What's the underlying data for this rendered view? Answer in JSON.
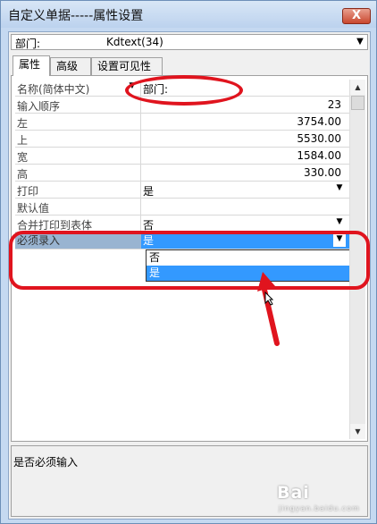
{
  "window": {
    "title": "自定义单据-----属性设置",
    "close": "X"
  },
  "object_combo": {
    "label": "部门:",
    "value": "Kdtext(34)"
  },
  "tabs": [
    {
      "label": "属性"
    },
    {
      "label": "高级"
    },
    {
      "label": "设置可见性"
    }
  ],
  "properties": [
    {
      "name": "名称(简体中文)",
      "value": "部门:"
    },
    {
      "name": "输入顺序",
      "value": "23"
    },
    {
      "name": "左",
      "value": "3754.00"
    },
    {
      "name": "上",
      "value": "5530.00"
    },
    {
      "name": "宽",
      "value": "1584.00"
    },
    {
      "name": "高",
      "value": "330.00"
    },
    {
      "name": "打印",
      "value": "是"
    },
    {
      "name": "默认值",
      "value": ""
    },
    {
      "name": "合并打印到表体",
      "value": "否"
    },
    {
      "name": "必须录入",
      "value": "是"
    }
  ],
  "dropdown_options": [
    {
      "label": "否"
    },
    {
      "label": "是"
    }
  ],
  "description": "是否必须输入",
  "watermark": "Bai",
  "watermark_sub": "jingyan.baidu.com",
  "icons": {
    "dropdown": "▼",
    "scroll_up": "▲",
    "scroll_down": "▼"
  },
  "annotation_color": "#e0141e"
}
